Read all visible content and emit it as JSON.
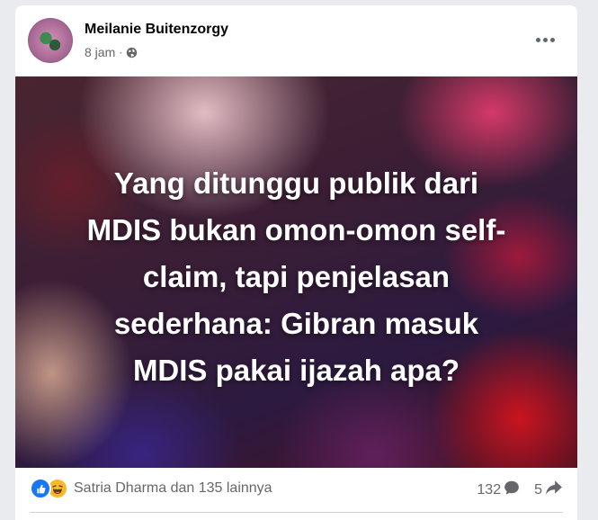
{
  "post": {
    "author": "Meilanie Buitenzorgy",
    "time": "8 jam",
    "separator": "·",
    "image_text_lines": [
      "Yang ditunggu publik dari",
      "MDIS bukan omon-omon self-",
      "claim, tapi penjelasan",
      "sederhana: Gibran masuk",
      "MDIS pakai ijazah apa?"
    ],
    "reactions_text": "Satria Dharma dan 135 lainnya",
    "comments_count": "132",
    "shares_count": "5"
  },
  "icons": {
    "globe": "globe-icon",
    "more": "more-options-icon",
    "like": "like-reaction-icon",
    "haha": "haha-reaction-icon",
    "comment": "comment-icon",
    "share": "share-icon"
  },
  "colors": {
    "like": "#1877f2",
    "haha": "#f7b928",
    "meta_text": "#65676b",
    "author_text": "#050505"
  }
}
